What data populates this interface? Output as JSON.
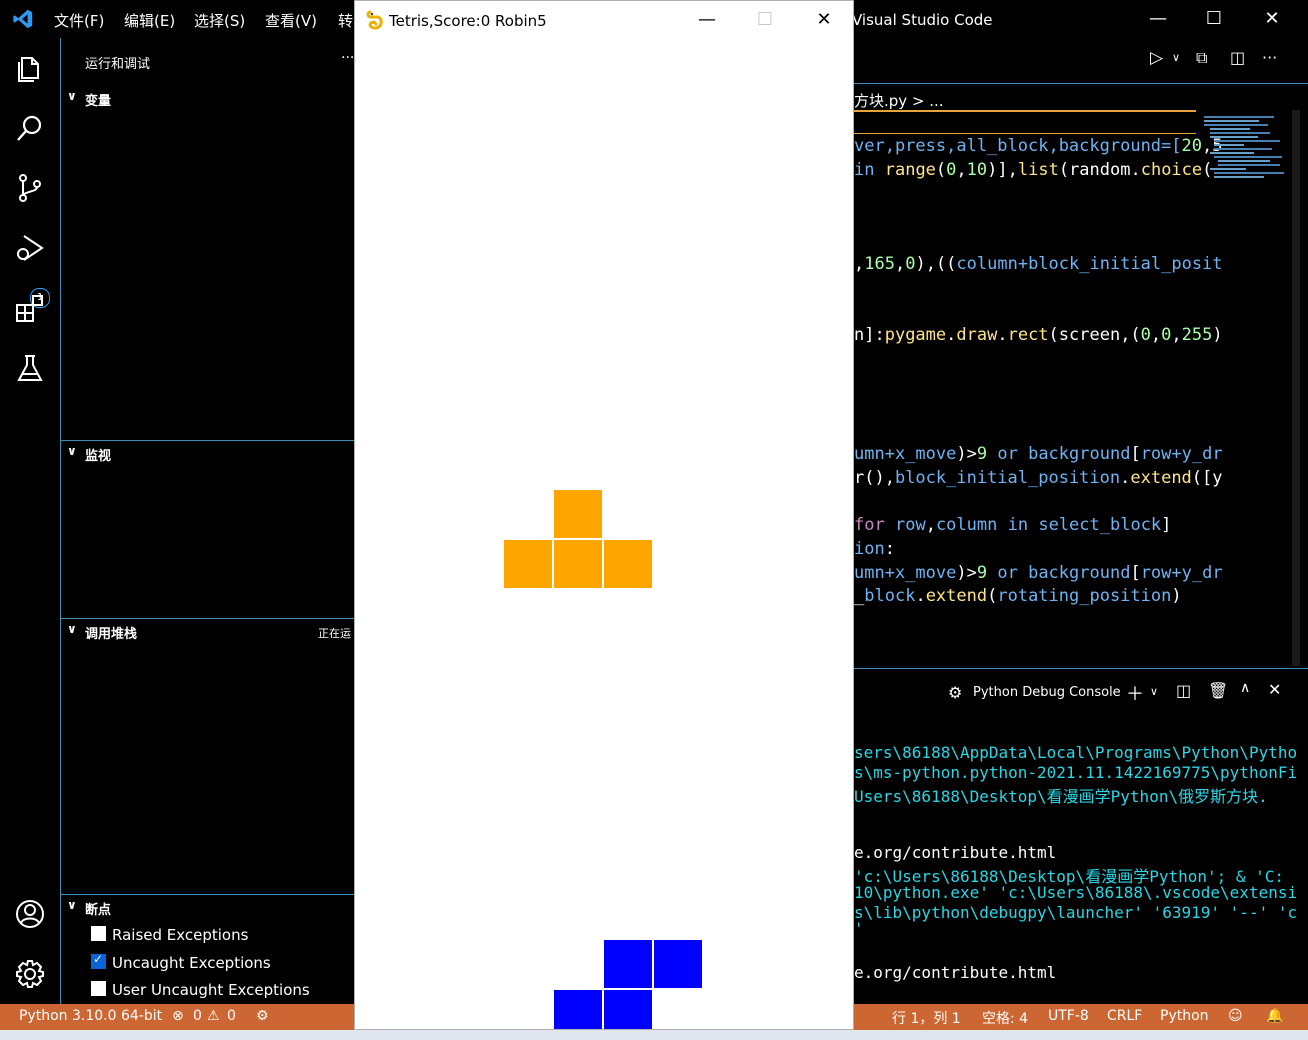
{
  "vscode": {
    "menu": [
      "文件(F)",
      "编辑(E)",
      "选择(S)",
      "查看(V)",
      "转"
    ],
    "title": "Visual Studio Code",
    "debug_badge": "1"
  },
  "sidebar": {
    "header": "运行和调试",
    "more": "···",
    "sections": {
      "variables": "变量",
      "watch": "监视",
      "callstack": "调用堆栈",
      "callstack_status": "正在运",
      "breakpoints": "断点"
    },
    "breakpoints": [
      {
        "label": "Raised Exceptions",
        "checked": false
      },
      {
        "label": "Uncaught Exceptions",
        "checked": true
      },
      {
        "label": "User Uncaught Exceptions",
        "checked": false
      }
    ]
  },
  "editor": {
    "breadcrumb": "方块.py > ...",
    "lines": [
      "ver,press,all_block,background=[20,5",
      " in range(0,10)],list(random.choice(",
      ",165,0),((column+block_initial_posit",
      "n]:pygame.draw.rect(screen,(0,0,255)",
      "umn+x_move)>9 or background[row+y_dr",
      "r(),block_initial_position.extend([y",
      "for row,column in select_block]",
      "ion:",
      "umn+x_move)>9 or background[row+y_dr",
      "_block.extend(rotating_position)"
    ]
  },
  "panel": {
    "title": "Python Debug Console",
    "lines": [
      "sers\\86188\\AppData\\Local\\Programs\\Python\\Pytho",
      "s\\ms-python.python-2021.11.1422169775\\pythonFi",
      "Users\\86188\\Desktop\\看漫画学Python\\俄罗斯方块.",
      "e.org/contribute.html",
      "'c:\\Users\\86188\\Desktop\\看漫画学Python'; & 'C:",
      "10\\python.exe' 'c:\\Users\\86188\\.vscode\\extensi",
      "s\\lib\\python\\debugpy\\launcher' '63919' '--' 'c",
      "'",
      "e.org/contribute.html"
    ]
  },
  "statusbar": {
    "python": "Python 3.10.0 64-bit",
    "errors": "0",
    "warnings": "0",
    "position": "行 1，列 1",
    "spaces": "空格: 4",
    "encoding": "UTF-8",
    "eol": "CRLF",
    "language": "Python"
  },
  "game": {
    "title": "Tetris,Score:0 Robin5",
    "colors": {
      "orange": "#ffa500",
      "blue": "#0000ff"
    }
  }
}
